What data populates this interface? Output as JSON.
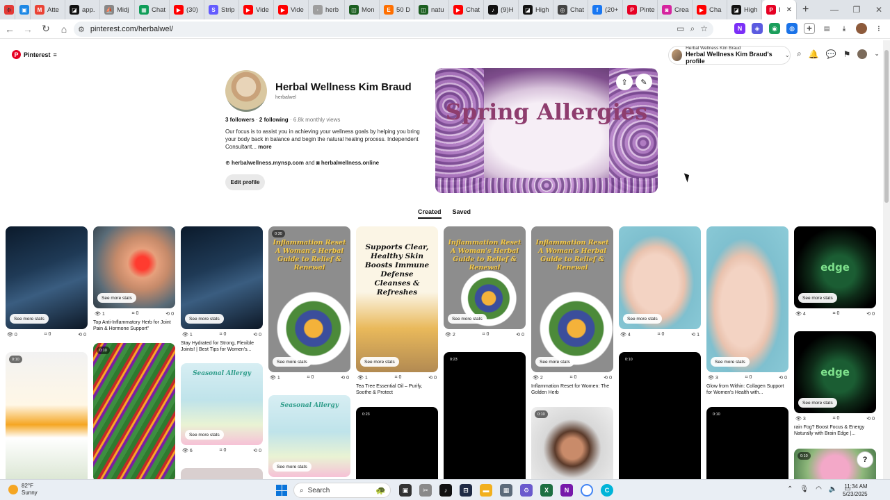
{
  "browser": {
    "tabs": [
      {
        "label": "",
        "fav_color": "#e53935",
        "fav_glyph": "🐞"
      },
      {
        "label": "",
        "fav_color": "#1e88e5",
        "fav_glyph": "▣"
      },
      {
        "label": "Atte",
        "fav_color": "#ea4335",
        "fav_glyph": "M"
      },
      {
        "label": "app.",
        "fav_color": "#111111",
        "fav_glyph": "◪"
      },
      {
        "label": "Midj",
        "fav_color": "#888888",
        "fav_glyph": "⛵"
      },
      {
        "label": "Chat",
        "fav_color": "#0f9d58",
        "fav_glyph": "▦"
      },
      {
        "label": "(30)",
        "fav_color": "#ff0000",
        "fav_glyph": "▶"
      },
      {
        "label": "Strip",
        "fav_color": "#635bff",
        "fav_glyph": "S"
      },
      {
        "label": "Vide",
        "fav_color": "#ff0000",
        "fav_glyph": "▶"
      },
      {
        "label": "Vide",
        "fav_color": "#ff0000",
        "fav_glyph": "▶"
      },
      {
        "label": "herb",
        "fav_color": "#9e9e9e",
        "fav_glyph": "·"
      },
      {
        "label": "Mon",
        "fav_color": "#1b5e20",
        "fav_glyph": "◫"
      },
      {
        "label": "50 D",
        "fav_color": "#ff6f00",
        "fav_glyph": "E"
      },
      {
        "label": "natu",
        "fav_color": "#1b5e20",
        "fav_glyph": "◫"
      },
      {
        "label": "Chat",
        "fav_color": "#ff0000",
        "fav_glyph": "▶"
      },
      {
        "label": "(9)H",
        "fav_color": "#111111",
        "fav_glyph": "♪"
      },
      {
        "label": "High",
        "fav_color": "#111111",
        "fav_glyph": "◪"
      },
      {
        "label": "Chat",
        "fav_color": "#444444",
        "fav_glyph": "◎"
      },
      {
        "label": "(20+",
        "fav_color": "#1877f2",
        "fav_glyph": "f"
      },
      {
        "label": "Pinte",
        "fav_color": "#e60023",
        "fav_glyph": "P"
      },
      {
        "label": "Crea",
        "fav_color": "#d6249f",
        "fav_glyph": "◙"
      },
      {
        "label": "Cha",
        "fav_color": "#ff0000",
        "fav_glyph": "▶"
      },
      {
        "label": "High",
        "fav_color": "#111111",
        "fav_glyph": "◪"
      },
      {
        "label": "I",
        "fav_color": "#e60023",
        "fav_glyph": "P"
      }
    ],
    "url": "pinterest.com/herbalwel/"
  },
  "pinterest": {
    "logo_label": "Pinterest",
    "account_switch": {
      "top_label": "Herbal Wellness Kim Braud",
      "main_label": "Herbal Wellness Kim Braud's profile"
    },
    "profile": {
      "name": "Herbal Wellness Kim Braud",
      "handle": "herbalwel",
      "followers": "3 followers",
      "following": "2 following",
      "monthly_views": "6.8k monthly views",
      "bio": "Our focus is to assist you in achieving your wellness goals by helping you bring your body back in balance and begin the natural healing process. Independent Consultant...",
      "more_label": "more",
      "website": "herbalwellness.mynsp.com",
      "and_text": "and",
      "instagram": "herbalwellness.online",
      "edit_label": "Edit profile"
    },
    "cover_title": "Spring Allergies",
    "tabs": [
      "Created",
      "Saved"
    ],
    "see_more_stats": "See more stats",
    "pins": [
      {
        "video": "",
        "views": "0",
        "saves": "0",
        "repins": "0",
        "title": "",
        "overlay": ""
      },
      {
        "video": "",
        "views": "1",
        "saves": "0",
        "repins": "0",
        "title": "Top Anti-Inflammatory Herb for Joint Pain & Hormone Support\"",
        "overlay": ""
      },
      {
        "video": "",
        "views": "1",
        "saves": "0",
        "repins": "0",
        "title": "Stay Hydrated for Strong, Flexible Joints! | Best Tips for Women's...",
        "overlay": ""
      },
      {
        "video": "0:30",
        "views": "1",
        "saves": "0",
        "repins": "0",
        "title": "",
        "overlay": "Inflammation Reset A Woman's Herbal Guide to Relief & Renewal"
      },
      {
        "video": "",
        "views": "1",
        "saves": "0",
        "repins": "0",
        "title": "Tea Tree Essential Oil – Purify, Soothe & Protect",
        "overlay": "Supports Clear, Healthy Skin Boosts Immune Defense Cleanses & Refreshes"
      },
      {
        "video": "",
        "views": "2",
        "saves": "0",
        "repins": "0",
        "title": "",
        "overlay": "Inflammation Reset A Woman's Herbal Guide to Relief & Renewal"
      },
      {
        "video": "",
        "views": "2",
        "saves": "0",
        "repins": "0",
        "title": "Inflammation Reset for Women: The Golden Herb",
        "overlay": "Inflammation Reset A Woman's Herbal Guide to Relief & Renewal"
      },
      {
        "video": "",
        "views": "4",
        "saves": "0",
        "repins": "1",
        "title": "",
        "overlay": ""
      },
      {
        "video": "",
        "views": "3",
        "saves": "0",
        "repins": "0",
        "title": "Glow from Within: Collagen Support for Women's Health with...",
        "overlay": ""
      },
      {
        "video": "",
        "views": "4",
        "saves": "0",
        "repins": "0",
        "title": "",
        "overlay": "edge"
      },
      {
        "video": "",
        "views": "3",
        "saves": "0",
        "repins": "0",
        "title": "rain Fog? Boost Focus & Energy Naturally with Brain Edge |...",
        "overlay": "edge"
      },
      {
        "video": "",
        "views": "6",
        "saves": "0",
        "repins": "0",
        "title": "",
        "overlay": "Seasonal Allergy"
      },
      {
        "video": "",
        "views": "",
        "saves": "",
        "repins": "",
        "title": "",
        "overlay": "Seasonal Allergy"
      },
      {
        "video": "0:10",
        "views": "",
        "saves": "",
        "repins": "",
        "title": "",
        "overlay": ""
      },
      {
        "video": "0:10",
        "views": "",
        "saves": "",
        "repins": "",
        "title": "",
        "overlay": ""
      },
      {
        "video": "0:23",
        "views": "",
        "saves": "",
        "repins": "",
        "title": "",
        "overlay": ""
      },
      {
        "video": "0:23",
        "views": "",
        "saves": "",
        "repins": "",
        "title": "",
        "overlay": ""
      },
      {
        "video": "0:10",
        "views": "",
        "saves": "",
        "repins": "",
        "title": "",
        "overlay": ""
      },
      {
        "video": "0:10",
        "views": "",
        "saves": "",
        "repins": "",
        "title": "",
        "overlay": ""
      },
      {
        "video": "0:10",
        "views": "",
        "saves": "",
        "repins": "",
        "title": "",
        "overlay": ""
      },
      {
        "video": "0:10",
        "views": "",
        "saves": "",
        "repins": "",
        "title": "",
        "overlay": ""
      }
    ]
  },
  "taskbar": {
    "temperature": "82°F",
    "weather": "Sunny",
    "search_label": "Search",
    "time": "11:34 AM",
    "date": "5/23/2025"
  },
  "colors": {
    "pinterest_red": "#e60023",
    "windows_blue": "#0a74da"
  }
}
